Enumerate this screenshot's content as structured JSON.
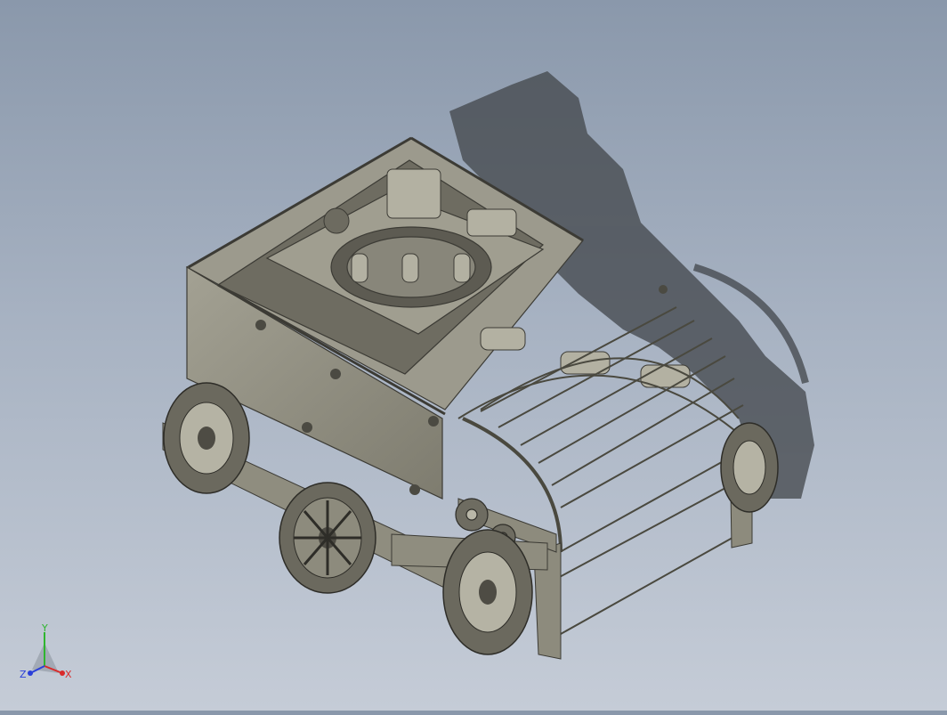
{
  "scene": {
    "subject": "cad-robot-assembly",
    "background_top": "#8a98ab",
    "background_bottom": "#c5ccd7",
    "part_fill": "#8d8b7d",
    "part_dark": "#5d5b52",
    "part_light": "#b9b7a8",
    "shadow": "#3f4348"
  },
  "triad": {
    "y_label": "Y",
    "x_label": "X",
    "z_label": "Z",
    "y_color": "#2fb52f",
    "x_color": "#d92a2a",
    "z_color": "#2a3fd9"
  }
}
